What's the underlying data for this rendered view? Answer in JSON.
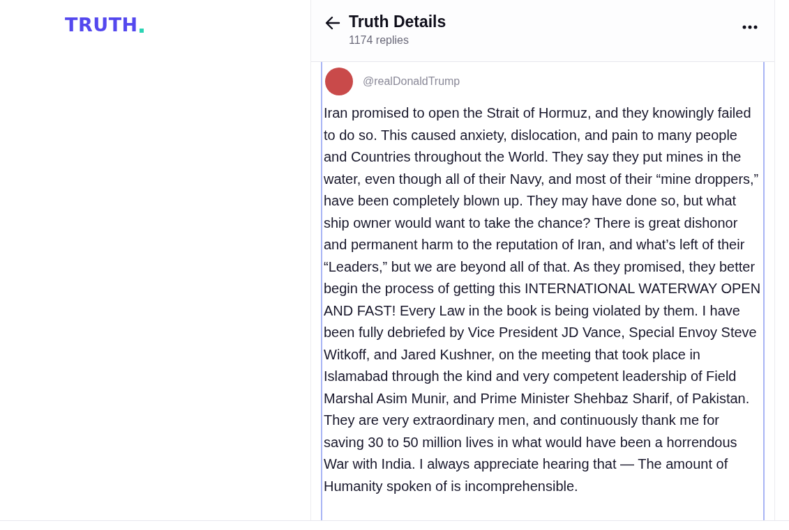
{
  "logo": {
    "text": "TRUTH"
  },
  "header": {
    "title": "Truth Details",
    "subtitle": "1174 replies"
  },
  "post": {
    "handle": "@realDonaldTrump",
    "body": "Iran promised to open the Strait of Hormuz, and they knowingly failed to do so. This caused anxiety, dislocation, and pain to many people and Countries throughout the World. They say they put mines in the water, even though all of their Navy, and most of their “mine droppers,” have been completely blown up. They may have done so, but what ship owner would want to take the chance? There is great dishonor and permanent harm to the reputation of Iran, and what’s left of their “Leaders,” but we are beyond all of that. As they promised, they better begin the process of getting this INTERNATIONAL WATERWAY OPEN AND FAST! Every Law in the book is being violated by them. I have been fully debriefed by Vice President JD Vance, Special Envoy Steve Witkoff, and Jared Kushner, on the meeting that took place in Islamabad through the kind and very competent leadership of Field Marshal Asim Munir, and Prime Minister Shehbaz Sharif, of Pakistan. They are very extraordinary men, and continuously thank me for saving 30 to 50 million lives in what would have been a horrendous War with India. I always appreciate hearing that — The amount of Humanity spoken of is incomprehensible."
  }
}
